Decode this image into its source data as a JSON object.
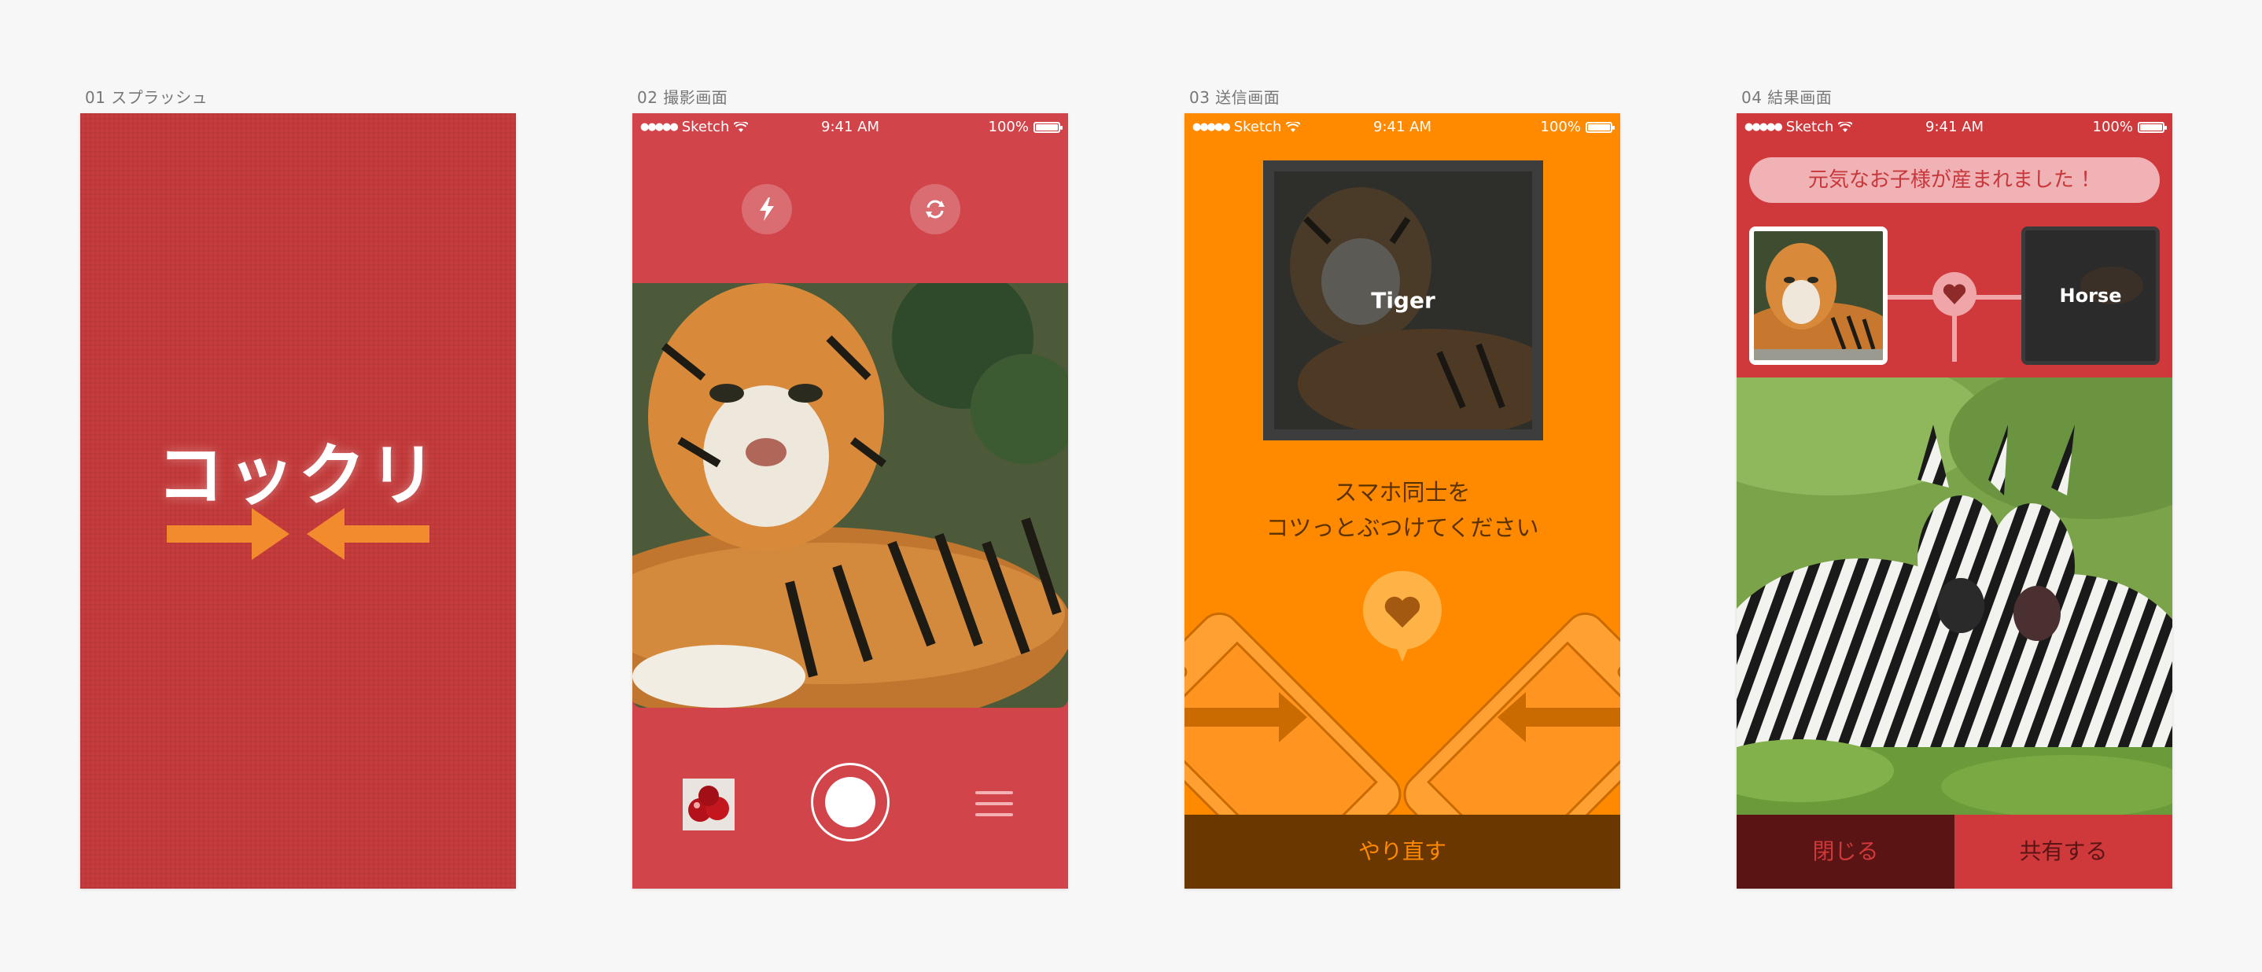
{
  "artboards": [
    {
      "label": "01 スプラッシュ"
    },
    {
      "label": "02 撮影画面"
    },
    {
      "label": "03 送信画面"
    },
    {
      "label": "04 結果画面"
    }
  ],
  "status_bar": {
    "carrier": "Sketch",
    "time": "9:41 AM",
    "battery": "100%"
  },
  "splash": {
    "logo_text": "コックリ",
    "brand_color": "#c63b3b",
    "arrow_color": "#f28a2e"
  },
  "camera": {
    "flash_icon": "lightning-icon",
    "switch_icon": "camera-switch-icon",
    "shutter_icon": "shutter-button",
    "menu_icon": "hamburger-menu-icon",
    "background_color": "#d0444a"
  },
  "send": {
    "photo_label": "Tiger",
    "instruction_line1": "スマホ同士を",
    "instruction_line2": "コツっとぶつけてください",
    "retry_button": "やり直す",
    "background_color": "#ff8a00"
  },
  "result": {
    "title": "元気なお子様が産まれました ！",
    "right_parent_label": "Horse",
    "close_button": "閉じる",
    "share_button": "共有する",
    "background_color": "#d0393c"
  }
}
